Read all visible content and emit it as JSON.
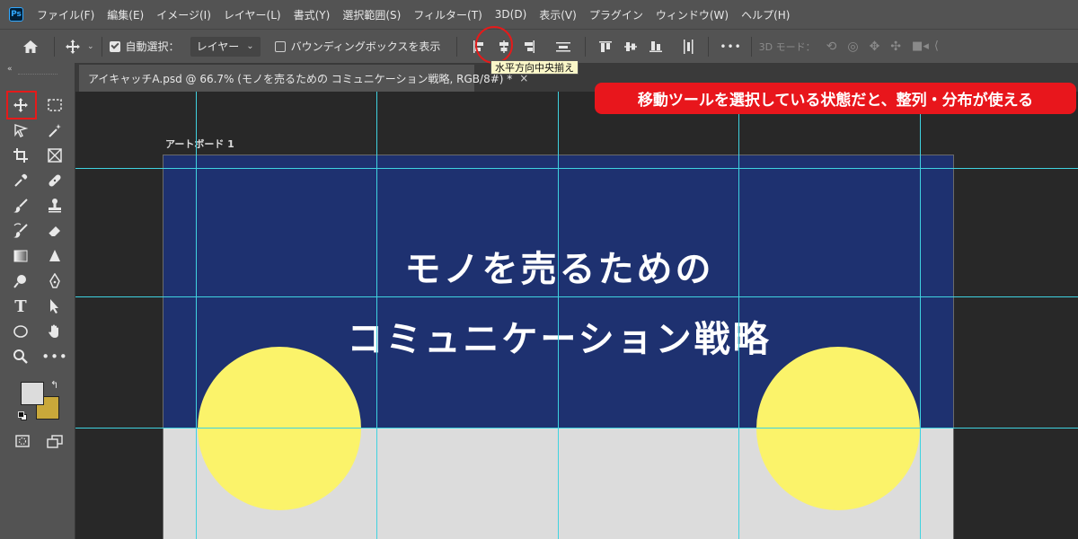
{
  "app": {
    "logo_text": "Ps"
  },
  "menu": [
    "ファイル(F)",
    "編集(E)",
    "イメージ(I)",
    "レイヤー(L)",
    "書式(Y)",
    "選択範囲(S)",
    "フィルター(T)",
    "3D(D)",
    "表示(V)",
    "プラグイン",
    "ウィンドウ(W)",
    "ヘルプ(H)"
  ],
  "options": {
    "auto_select_label": "自動選択：",
    "auto_select_checked": true,
    "auto_select_target": "レイヤー",
    "bounding_box_label": "バウンディングボックスを表示",
    "bounding_box_checked": false,
    "more_label": "•••",
    "mode_3d_label": "3D モード："
  },
  "tooltip": "水平方向中央揃え",
  "document": {
    "tab_title": "アイキャッチA.psd @ 66.7% (モノを売るための コミュニケーション戦略, RGB/8#) *",
    "close_glyph": "×"
  },
  "artboard": {
    "label": "アートボード 1",
    "title_line1": "モノを売るための",
    "title_line2": "コミュニケーション戦略"
  },
  "callout": "移動ツールを選択している状態だと、整列・分布が使える",
  "colors": {
    "banner": "#1e3170",
    "circle": "#fbf36a",
    "guide": "#3fd2e0",
    "highlight": "#e61a1a",
    "foreground_swatch": "#dcdcdc",
    "background_swatch": "#c9a83a"
  },
  "icons": {
    "home": "home-icon",
    "move": "move-icon"
  }
}
